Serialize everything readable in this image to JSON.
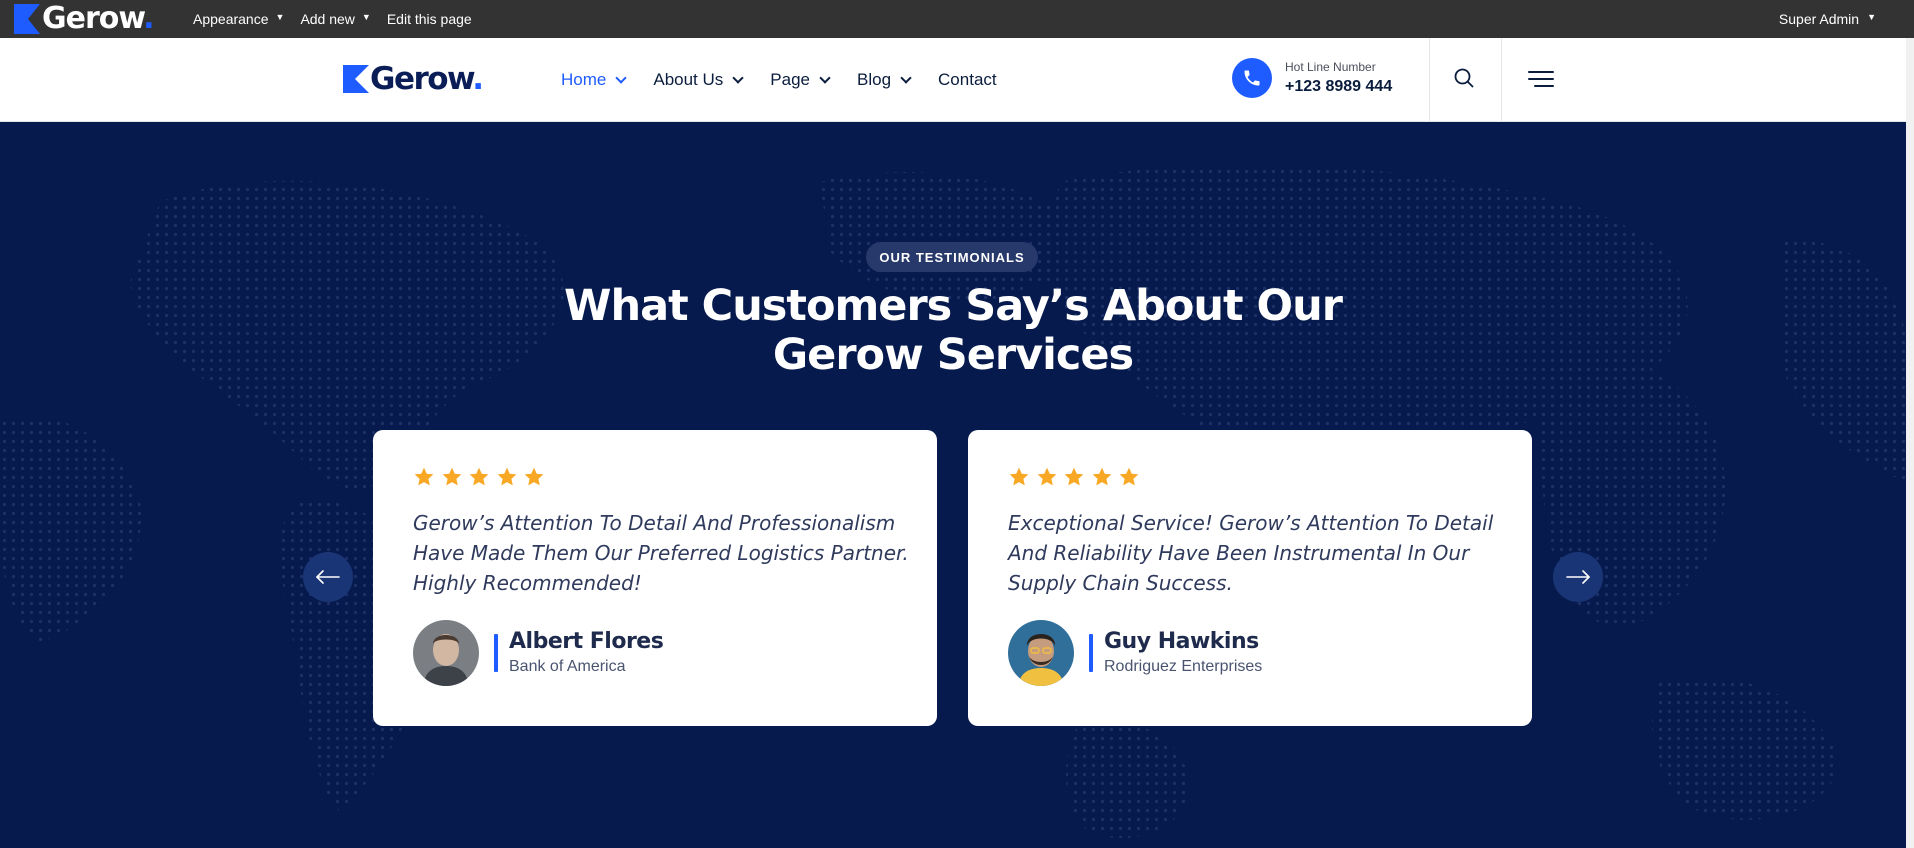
{
  "admin_bar": {
    "logo_text": "Gerow",
    "logo_dot": ".",
    "menu": [
      {
        "label": "Appearance"
      },
      {
        "label": "Add new"
      },
      {
        "label": "Edit this page"
      }
    ],
    "user": "Super Admin"
  },
  "header": {
    "logo_text": "Gerow",
    "logo_dot": ".",
    "nav": [
      {
        "label": "Home",
        "active": true
      },
      {
        "label": "About Us"
      },
      {
        "label": "Page"
      },
      {
        "label": "Blog"
      },
      {
        "label": "Contact"
      }
    ],
    "hotline_label": "Hot Line Number",
    "hotline_number": "+123 8989 444"
  },
  "testimonials": {
    "tag": "OUR TESTIMONIALS",
    "title_line1": "What Customers Say’s About Our",
    "title_line2": "Gerow Services",
    "cards": [
      {
        "rating": 5,
        "quote": "Gerow’s Attention To Detail And Professionalism Have Made Them Our Preferred Logistics Partner. Highly Recommended!",
        "name": "Albert Flores",
        "company": "Bank of America"
      },
      {
        "rating": 5,
        "quote": "Exceptional Service! Gerow’s Attention To Detail And Reliability Have Been Instrumental In Our Supply Chain Success.",
        "name": "Guy Hawkins",
        "company": "Rodriguez Enterprises"
      }
    ]
  },
  "colors": {
    "brand_blue": "#1f5cff",
    "navy": "#061a4d",
    "star": "#f9a825",
    "admin_bar": "#333333"
  },
  "icons": [
    "phone-icon",
    "search-icon",
    "menu-icon",
    "star-icon",
    "arrow-left-icon",
    "arrow-right-icon"
  ]
}
